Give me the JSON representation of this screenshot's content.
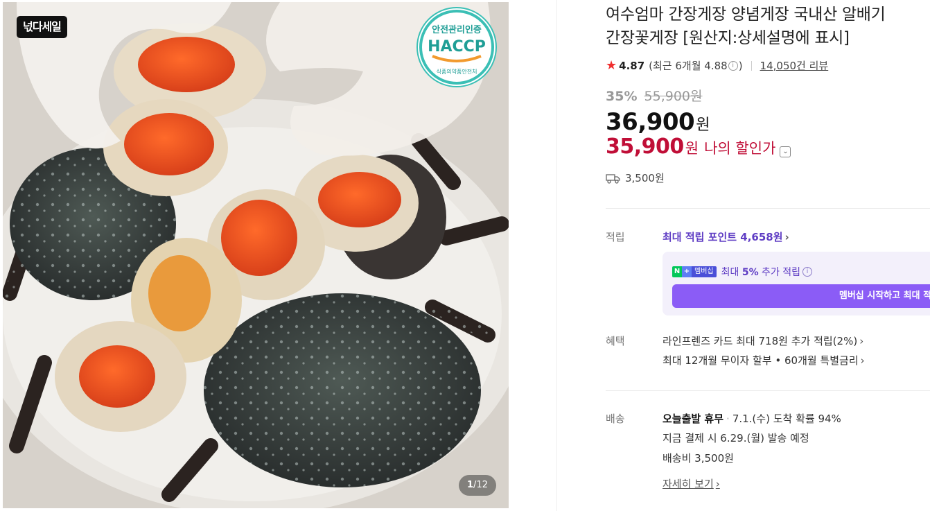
{
  "gallery": {
    "sale_badge": "넋다세일",
    "haccp": {
      "top_text": "안전관리인증",
      "logo_text": "HACCP",
      "bottom_text": "식품의약품안전처"
    },
    "counter_current": "1",
    "counter_total": "12"
  },
  "product": {
    "title_line1": "여수엄마 간장게장 양념게장 국내산 알배기",
    "title_line2": "간장꽃게장 [원산지:상세설명에 표시]",
    "rating": "4.87",
    "recent_rating_label": "(최근 6개월 4.88",
    "recent_rating_close": ")",
    "review_count": "14,050건 리뷰",
    "discount_rate": "35%",
    "original_price": "55,900원",
    "price": "36,900",
    "price_unit": "원",
    "my_price": "35,900",
    "my_price_unit": "원",
    "my_price_label": "나의 할인가",
    "shipping_fee": "3,500원"
  },
  "points": {
    "label": "적립",
    "max_points": "최대 적립 포인트 4,658원",
    "membership_badge": "멤버십",
    "membership_prefix": "최대 ",
    "membership_rate": "5%",
    "membership_suffix": " 추가 적립",
    "membership_button": "멤버십 시작하고 최대 적립"
  },
  "benefits": {
    "label": "혜택",
    "line1": "라인프렌즈 카드 최대 718원 추가 적립(2%)",
    "line2": "최대 12개월 무이자 할부 • 60개월 특별금리"
  },
  "delivery": {
    "label": "배송",
    "dispatch": "오늘출발 휴무",
    "arrival": "7.1.(수) 도착 확률 94%",
    "schedule": "지금 결제 시 6.29.(월) 발송 예정",
    "fee": "배송비 3,500원",
    "more": "자세히 보기"
  },
  "colors": {
    "accent_red": "#c00e37",
    "point_purple": "#5f3dc4",
    "button_purple": "#8b5cf6",
    "star_red": "#f02f2f"
  }
}
